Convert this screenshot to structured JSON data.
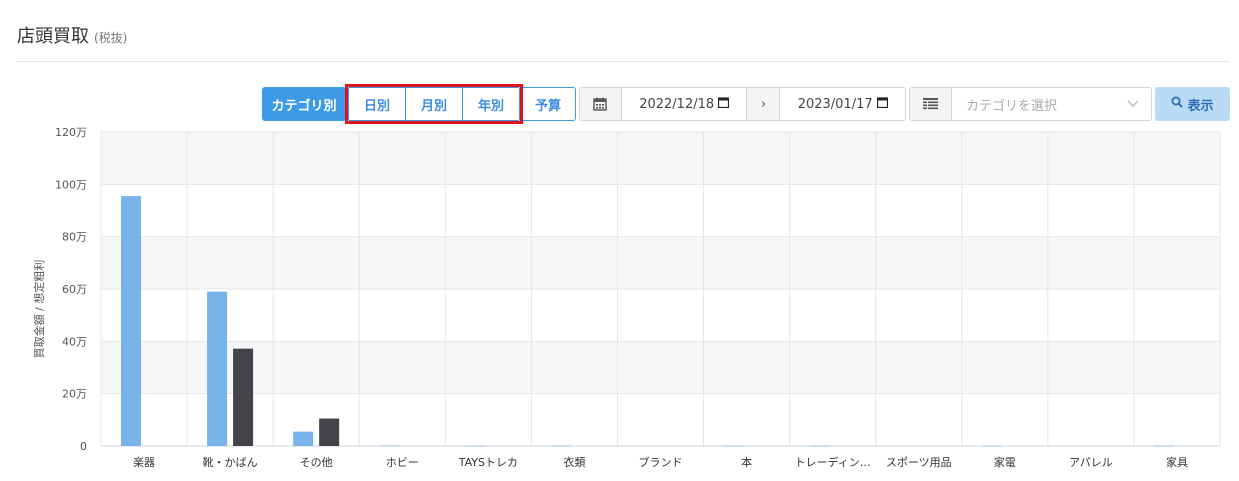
{
  "header": {
    "title": "店頭買取",
    "subtitle": "(税抜)"
  },
  "toolbar": {
    "category_btn": "カテゴリ別",
    "period_tabs": [
      "日別",
      "月別",
      "年別"
    ],
    "budget_btn": "予算",
    "date_from": "2022/12/18",
    "date_to": "2023/01/17",
    "date_separator": "›",
    "category_placeholder": "カテゴリを選択",
    "show_btn": "表示"
  },
  "icons": {
    "calendar": "calendar-icon",
    "list": "list-icon",
    "chevron": "chevron-down-icon",
    "search": "search-icon"
  },
  "colors": {
    "primary": "#3d9ae5",
    "highlight": "#e0141e",
    "series_1": "#7ab3ea",
    "series_2": "#434348",
    "show_btn_bg": "#b9daf4"
  },
  "chart_data": {
    "type": "bar",
    "ylabel": "買取金額 / 想定粗利",
    "ylim": [
      0,
      1200000
    ],
    "yticks": [
      0,
      200000,
      400000,
      600000,
      800000,
      1000000,
      1200000
    ],
    "ytick_labels": [
      "0",
      "20万",
      "40万",
      "60万",
      "80万",
      "100万",
      "120万"
    ],
    "categories": [
      "楽器",
      "靴・かばん",
      "その他",
      "ホビー",
      "TAYSトレカ",
      "衣類",
      "ブランド",
      "本",
      "トレーディン…",
      "スポーツ用品",
      "家電",
      "アパレル",
      "家具"
    ],
    "series": [
      {
        "values": [
          955000,
          590000,
          55000,
          2000,
          1000,
          1500,
          0,
          1000,
          500,
          0,
          1000,
          0,
          1000
        ],
        "color": "#7ab3ea"
      },
      {
        "values": [
          0,
          372000,
          105000,
          0,
          0,
          0,
          0,
          0,
          0,
          0,
          0,
          0,
          0
        ],
        "color": "#434348"
      }
    ],
    "grid": true,
    "legend": "none"
  }
}
